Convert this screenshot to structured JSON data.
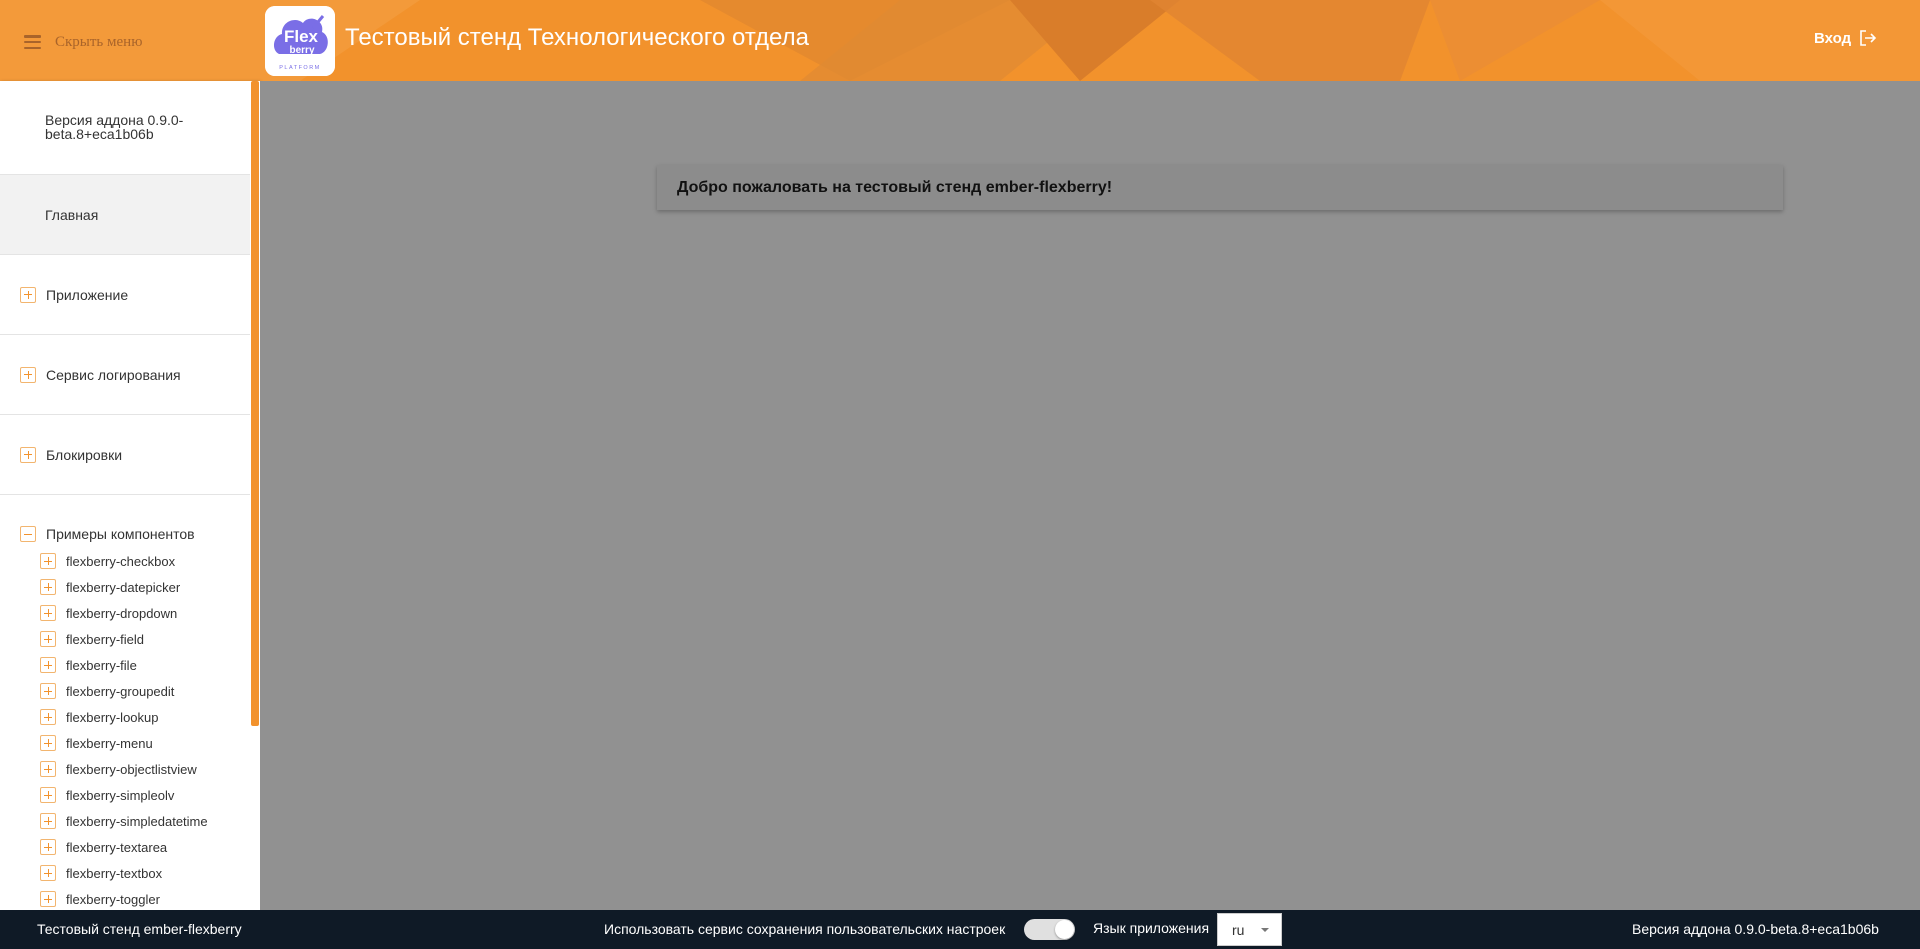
{
  "header": {
    "menu_toggle_label": "Скрыть меню",
    "app_title": "Тестовый стенд Технологического отдела",
    "login_label": "Вход",
    "logo_text": "Flex berry PLATFORM"
  },
  "sidebar": {
    "version": "Версия аддона 0.9.0-beta.8+eca1b06b",
    "home": "Главная",
    "groups": [
      {
        "label": "Приложение",
        "icon": "plus-square-icon"
      },
      {
        "label": "Сервис логирования",
        "icon": "plus-square-icon"
      },
      {
        "label": "Блокировки",
        "icon": "plus-square-icon"
      }
    ],
    "components_label": "Примеры компонентов",
    "components": [
      "flexberry-checkbox",
      "flexberry-datepicker",
      "flexberry-dropdown",
      "flexberry-field",
      "flexberry-file",
      "flexberry-groupedit",
      "flexberry-lookup",
      "flexberry-menu",
      "flexberry-objectlistview",
      "flexberry-simpleolv",
      "flexberry-simpledatetime",
      "flexberry-textarea",
      "flexberry-textbox",
      "flexberry-toggler"
    ]
  },
  "main": {
    "welcome": "Добро пожаловать на тестовый стенд ember-flexberry!"
  },
  "footer": {
    "left": "Тестовый стенд ember-flexberry",
    "user_settings_label": "Использовать сервис сохранения пользовательских настроек",
    "user_settings_enabled": true,
    "language_label": "Язык приложения",
    "language_value": "ru",
    "version": "Версия аддона 0.9.0-beta.8+eca1b06b"
  },
  "colors": {
    "accent": "#f2922c",
    "footer_bg": "#0f1a26",
    "overlay_bg": "#919191"
  }
}
